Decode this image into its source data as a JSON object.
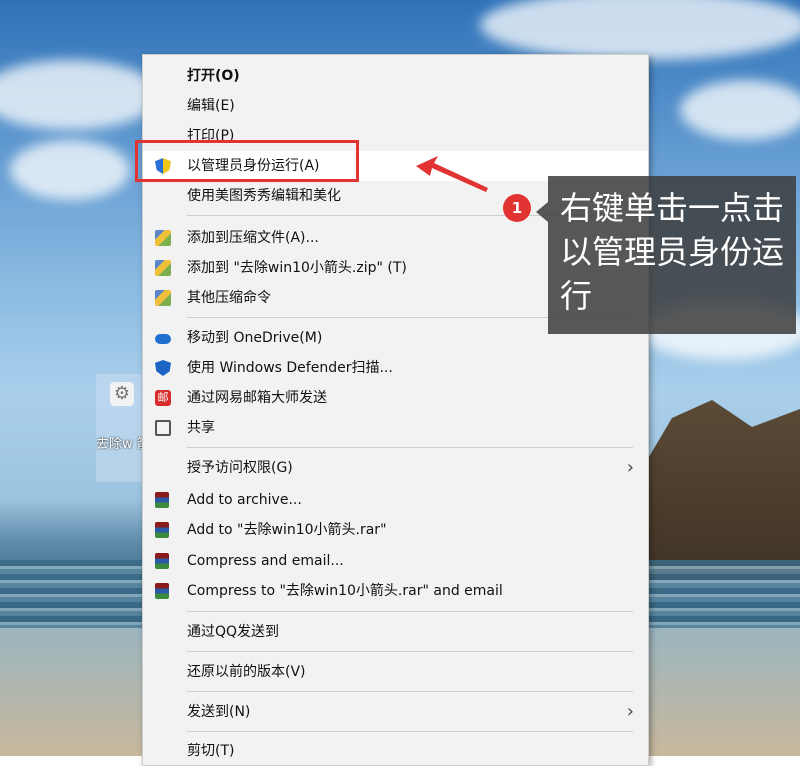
{
  "desktop": {
    "icon_label": "去除w 箭头"
  },
  "menu": {
    "items": [
      {
        "label": "打开(O)",
        "icon": "none",
        "bold": true
      },
      {
        "label": "编辑(E)",
        "icon": "none"
      },
      {
        "label": "打印(P)",
        "icon": "none"
      },
      {
        "label": "以管理员身份运行(A)",
        "icon": "uac-shield-icon"
      },
      {
        "label": "使用美图秀秀编辑和美化",
        "icon": "none"
      },
      {
        "label": "添加到压缩文件(A)...",
        "icon": "archive-icon"
      },
      {
        "label": "添加到 \"去除win10小箭头.zip\" (T)",
        "icon": "archive-icon"
      },
      {
        "label": "其他压缩命令",
        "icon": "archive-icon"
      },
      {
        "label": "移动到 OneDrive(M)",
        "icon": "onedrive-icon"
      },
      {
        "label": "使用 Windows Defender扫描...",
        "icon": "defender-icon"
      },
      {
        "label": "通过网易邮箱大师发送",
        "icon": "netease-mail-icon"
      },
      {
        "label": "共享",
        "icon": "share-icon"
      },
      {
        "label": "授予访问权限(G)",
        "icon": "none",
        "submenu": true
      },
      {
        "label": "Add to archive...",
        "icon": "winrar-icon"
      },
      {
        "label": "Add to \"去除win10小箭头.rar\"",
        "icon": "winrar-icon"
      },
      {
        "label": "Compress and email...",
        "icon": "winrar-icon"
      },
      {
        "label": "Compress to \"去除win10小箭头.rar\" and email",
        "icon": "winrar-icon"
      },
      {
        "label": "通过QQ发送到",
        "icon": "none"
      },
      {
        "label": "还原以前的版本(V)",
        "icon": "none"
      },
      {
        "label": "发送到(N)",
        "icon": "none",
        "submenu": true
      },
      {
        "label": "剪切(T)",
        "icon": "none"
      }
    ],
    "mail_glyph": "邮",
    "submenu_arrow": "›"
  },
  "annotation": {
    "step_number": "1",
    "callout_text": "右键单击一点击以管理员身份运行",
    "highlight_color": "#e23333"
  }
}
